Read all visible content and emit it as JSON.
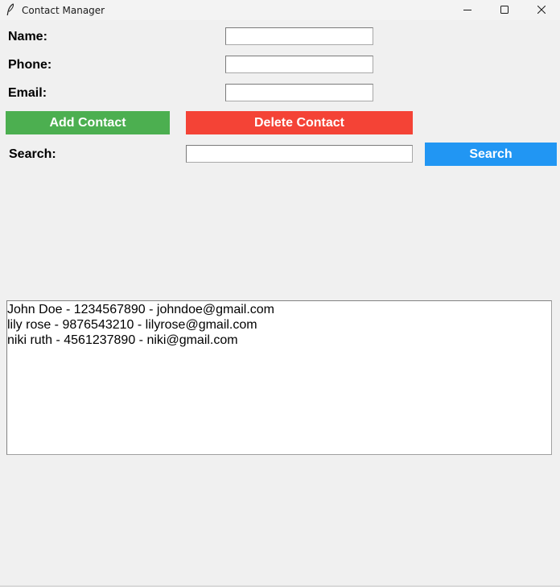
{
  "window": {
    "title": "Contact Manager"
  },
  "form": {
    "name_label": "Name:",
    "phone_label": "Phone:",
    "email_label": "Email:",
    "name_value": "",
    "phone_value": "",
    "email_value": ""
  },
  "buttons": {
    "add_label": "Add Contact",
    "delete_label": "Delete Contact",
    "search_label": "Search",
    "add_color": "#4caf50",
    "delete_color": "#f44336",
    "search_color": "#2196f3"
  },
  "search": {
    "label": "Search:",
    "value": ""
  },
  "contacts": [
    "John Doe - 1234567890 - johndoe@gmail.com",
    "lily rose - 9876543210 - lilyrose@gmail.com",
    "niki ruth - 4561237890 - niki@gmail.com"
  ],
  "icons": {
    "app": "feather-icon",
    "minimize": "minimize-icon",
    "maximize": "maximize-icon",
    "close": "close-icon"
  }
}
